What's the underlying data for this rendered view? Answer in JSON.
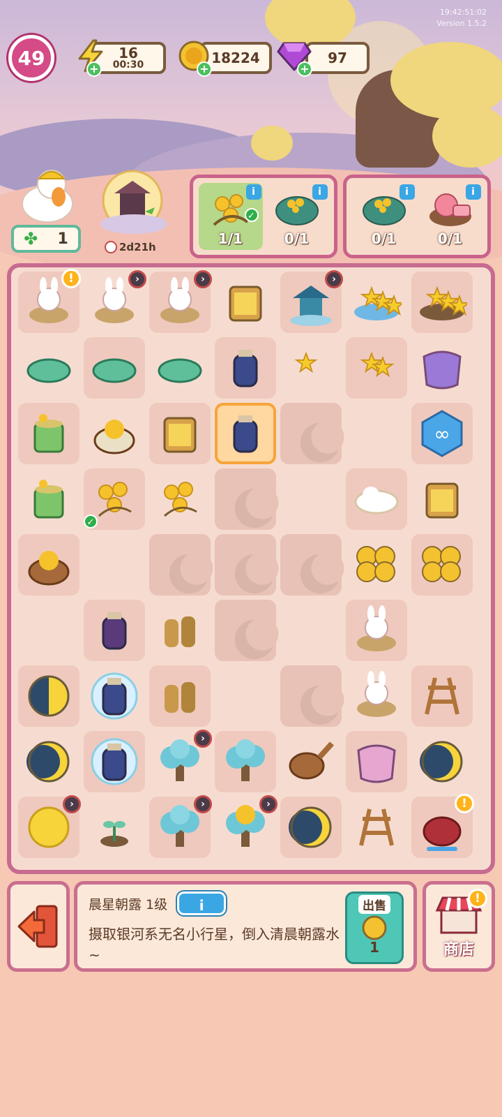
{
  "version_text": [
    "19:42:51:02",
    "Version 1.5.2"
  ],
  "top_bar": {
    "level": "49",
    "energy": {
      "value": "16",
      "timer": "00:30",
      "icon": "lightning-icon"
    },
    "coins": {
      "value": "18224",
      "icon": "coin-icon"
    },
    "gems": {
      "value": "97",
      "icon": "gem-icon"
    }
  },
  "helper": {
    "count": "1",
    "icon": "clover-icon"
  },
  "event": {
    "timer": "2d21h",
    "icon": "moon-pagoda-event-icon"
  },
  "orders": [
    {
      "items": [
        {
          "name": "osmanthus-flower",
          "count": "1/1",
          "done": true
        },
        {
          "name": "leaf-wrap",
          "count": "0/1",
          "done": false
        }
      ]
    },
    {
      "items": [
        {
          "name": "leaf-wrap",
          "count": "0/1",
          "done": false
        },
        {
          "name": "pink-mooncake-basket",
          "count": "0/1",
          "done": false
        }
      ]
    }
  ],
  "board": {
    "items": [
      "rabbit-mortar-producer",
      "bunny-mortar",
      "bunny-mortar-2",
      "lantern-box-stars",
      "moon-pagoda",
      "star-plate",
      "star-basket",
      "green-tray",
      "jade-bowl",
      "jade-flower-plate",
      "water-bottle",
      "star-1",
      "star-2",
      "purple-cloth",
      "bamboo-bucket",
      "jelly-cake",
      "lantern-jar",
      "dew-cup",
      "locked",
      "empty",
      "infinity-token",
      "bamboo-bucket-2",
      "osmanthus-flower",
      "osmanthus-sprig",
      "locked",
      "empty",
      "cloud",
      "lantern-box-stars-2",
      "flower-basket",
      "empty",
      "locked",
      "locked",
      "locked",
      "coin-stack",
      "coin-pile",
      "empty",
      "ink-bottle",
      "twine-rolls",
      "locked",
      "empty",
      "bunny-pillow",
      "empty",
      "half-moon",
      "bubble-jar",
      "thread-spool",
      "empty",
      "locked",
      "bunny-slippers",
      "loom-frame",
      "crescent-moon",
      "bubble-jars",
      "blue-tree",
      "blue-tree-2",
      "wooden-scoop",
      "pink-cloth",
      "mooncake",
      "full-moon",
      "sprout",
      "blue-tree-3",
      "osmanthus-tree",
      "taro-mooncake",
      "loom-glow",
      "red-teapot"
    ]
  },
  "info": {
    "title": "晨星朝露 1级",
    "info_button": "i",
    "description": "摄取银河系无名小行星，倒入清晨朝露水~",
    "sell_label": "出售",
    "sell_value": "1"
  },
  "shop": {
    "label": "商店",
    "alert": "!"
  },
  "colors": {
    "board_border": "#c76b90",
    "board_bg": "#f6dcd0",
    "accent_blue": "#3aa6e4",
    "level_pink": "#d54b87"
  }
}
